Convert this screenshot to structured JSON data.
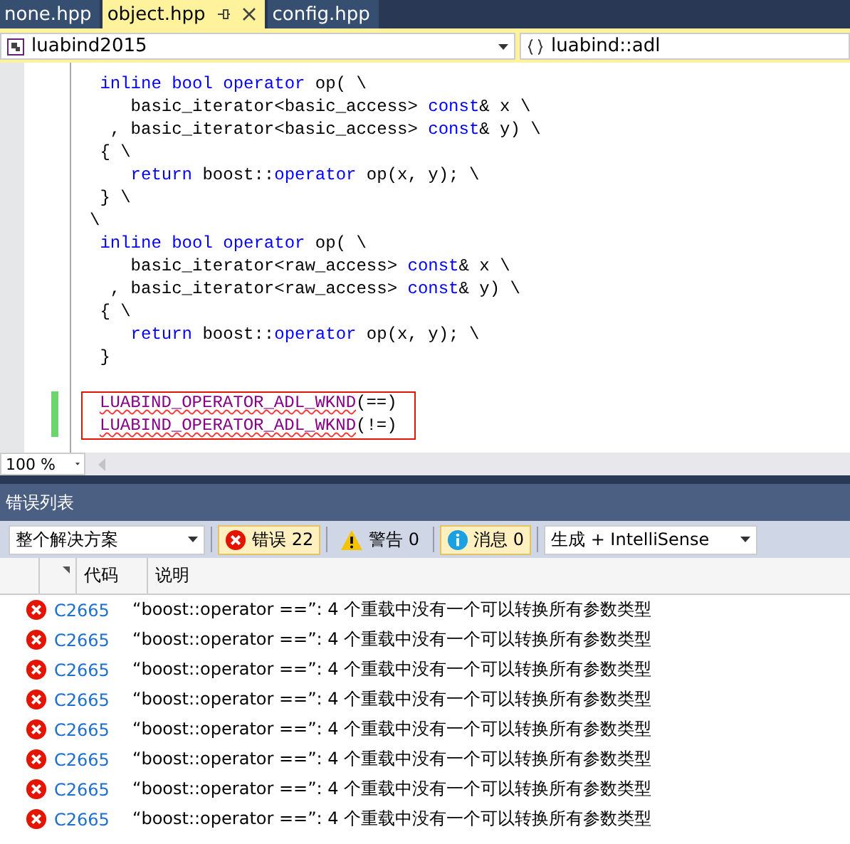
{
  "tabs": [
    {
      "label": "none.hpp",
      "selected": false
    },
    {
      "label": "object.hpp",
      "selected": true
    },
    {
      "label": "config.hpp",
      "selected": false
    }
  ],
  "nav": {
    "project": "luabind2015",
    "scope": "luabind::adl"
  },
  "code": {
    "lines": [
      {
        "modified": false,
        "boxed": false,
        "tokens": [
          {
            "kind": "keyword",
            "text": " inline bool operator"
          },
          {
            "kind": "text",
            "text": " op( \\"
          }
        ]
      },
      {
        "modified": false,
        "boxed": false,
        "tokens": [
          {
            "kind": "text",
            "text": "    basic_iterator<basic_access> "
          },
          {
            "kind": "keyword",
            "text": "const"
          },
          {
            "kind": "text",
            "text": "& x \\"
          }
        ]
      },
      {
        "modified": false,
        "boxed": false,
        "tokens": [
          {
            "kind": "text",
            "text": "  , basic_iterator<basic_access> "
          },
          {
            "kind": "keyword",
            "text": "const"
          },
          {
            "kind": "text",
            "text": "& y) \\"
          }
        ]
      },
      {
        "modified": false,
        "boxed": false,
        "tokens": [
          {
            "kind": "text",
            "text": " { \\"
          }
        ]
      },
      {
        "modified": false,
        "boxed": false,
        "tokens": [
          {
            "kind": "keyword",
            "text": "    return"
          },
          {
            "kind": "text",
            "text": " boost::"
          },
          {
            "kind": "keyword",
            "text": "operator"
          },
          {
            "kind": "text",
            "text": " op(x, y); \\"
          }
        ]
      },
      {
        "modified": false,
        "boxed": false,
        "tokens": [
          {
            "kind": "text",
            "text": " } \\"
          }
        ]
      },
      {
        "modified": false,
        "boxed": false,
        "tokens": [
          {
            "kind": "text",
            "text": "\\"
          }
        ]
      },
      {
        "modified": false,
        "boxed": false,
        "tokens": [
          {
            "kind": "keyword",
            "text": " inline bool operator"
          },
          {
            "kind": "text",
            "text": " op( \\"
          }
        ]
      },
      {
        "modified": false,
        "boxed": false,
        "tokens": [
          {
            "kind": "text",
            "text": "    basic_iterator<raw_access> "
          },
          {
            "kind": "keyword",
            "text": "const"
          },
          {
            "kind": "text",
            "text": "& x \\"
          }
        ]
      },
      {
        "modified": false,
        "boxed": false,
        "tokens": [
          {
            "kind": "text",
            "text": "  , basic_iterator<raw_access> "
          },
          {
            "kind": "keyword",
            "text": "const"
          },
          {
            "kind": "text",
            "text": "& y) \\"
          }
        ]
      },
      {
        "modified": false,
        "boxed": false,
        "tokens": [
          {
            "kind": "text",
            "text": " { \\"
          }
        ]
      },
      {
        "modified": false,
        "boxed": false,
        "tokens": [
          {
            "kind": "keyword",
            "text": "    return"
          },
          {
            "kind": "text",
            "text": " boost::"
          },
          {
            "kind": "keyword",
            "text": "operator"
          },
          {
            "kind": "text",
            "text": " op(x, y); \\"
          }
        ]
      },
      {
        "modified": false,
        "boxed": false,
        "tokens": [
          {
            "kind": "text",
            "text": " }"
          }
        ]
      },
      {
        "modified": false,
        "boxed": false
      },
      {
        "modified": true,
        "boxed": true,
        "tokens": [
          {
            "kind": "macro_error",
            "text": "LUABIND_OPERATOR_ADL_WKND"
          },
          {
            "kind": "text",
            "text": "(==)"
          }
        ]
      },
      {
        "modified": true,
        "boxed": true,
        "tokens": [
          {
            "kind": "macro_error",
            "text": "LUABIND_OPERATOR_ADL_WKND"
          },
          {
            "kind": "text",
            "text": "(!=)"
          }
        ]
      }
    ]
  },
  "zoom": "100 %",
  "error_list": {
    "title": "错误列表",
    "scope": "整个解决方案",
    "filters": [
      {
        "kind": "error",
        "label": "错误 22",
        "selected": true
      },
      {
        "kind": "warning",
        "label": "警告 0",
        "selected": false
      },
      {
        "kind": "info",
        "label": "消息 0",
        "selected": true
      }
    ],
    "source": "生成 + IntelliSense",
    "columns": [
      "代码",
      "说明"
    ],
    "rows": [
      {
        "code": "C2665",
        "description": "“boost::operator ==”: 4 个重载中没有一个可以转换所有参数类型"
      },
      {
        "code": "C2665",
        "description": "“boost::operator ==”: 4 个重载中没有一个可以转换所有参数类型"
      },
      {
        "code": "C2665",
        "description": "“boost::operator ==”: 4 个重载中没有一个可以转换所有参数类型"
      },
      {
        "code": "C2665",
        "description": "“boost::operator ==”: 4 个重载中没有一个可以转换所有参数类型"
      },
      {
        "code": "C2665",
        "description": "“boost::operator ==”: 4 个重载中没有一个可以转换所有参数类型"
      },
      {
        "code": "C2665",
        "description": "“boost::operator ==”: 4 个重载中没有一个可以转换所有参数类型"
      },
      {
        "code": "C2665",
        "description": "“boost::operator ==”: 4 个重载中没有一个可以转换所有参数类型"
      },
      {
        "code": "C2665",
        "description": "“boost::operator ==”: 4 个重载中没有一个可以转换所有参数类型"
      }
    ]
  }
}
